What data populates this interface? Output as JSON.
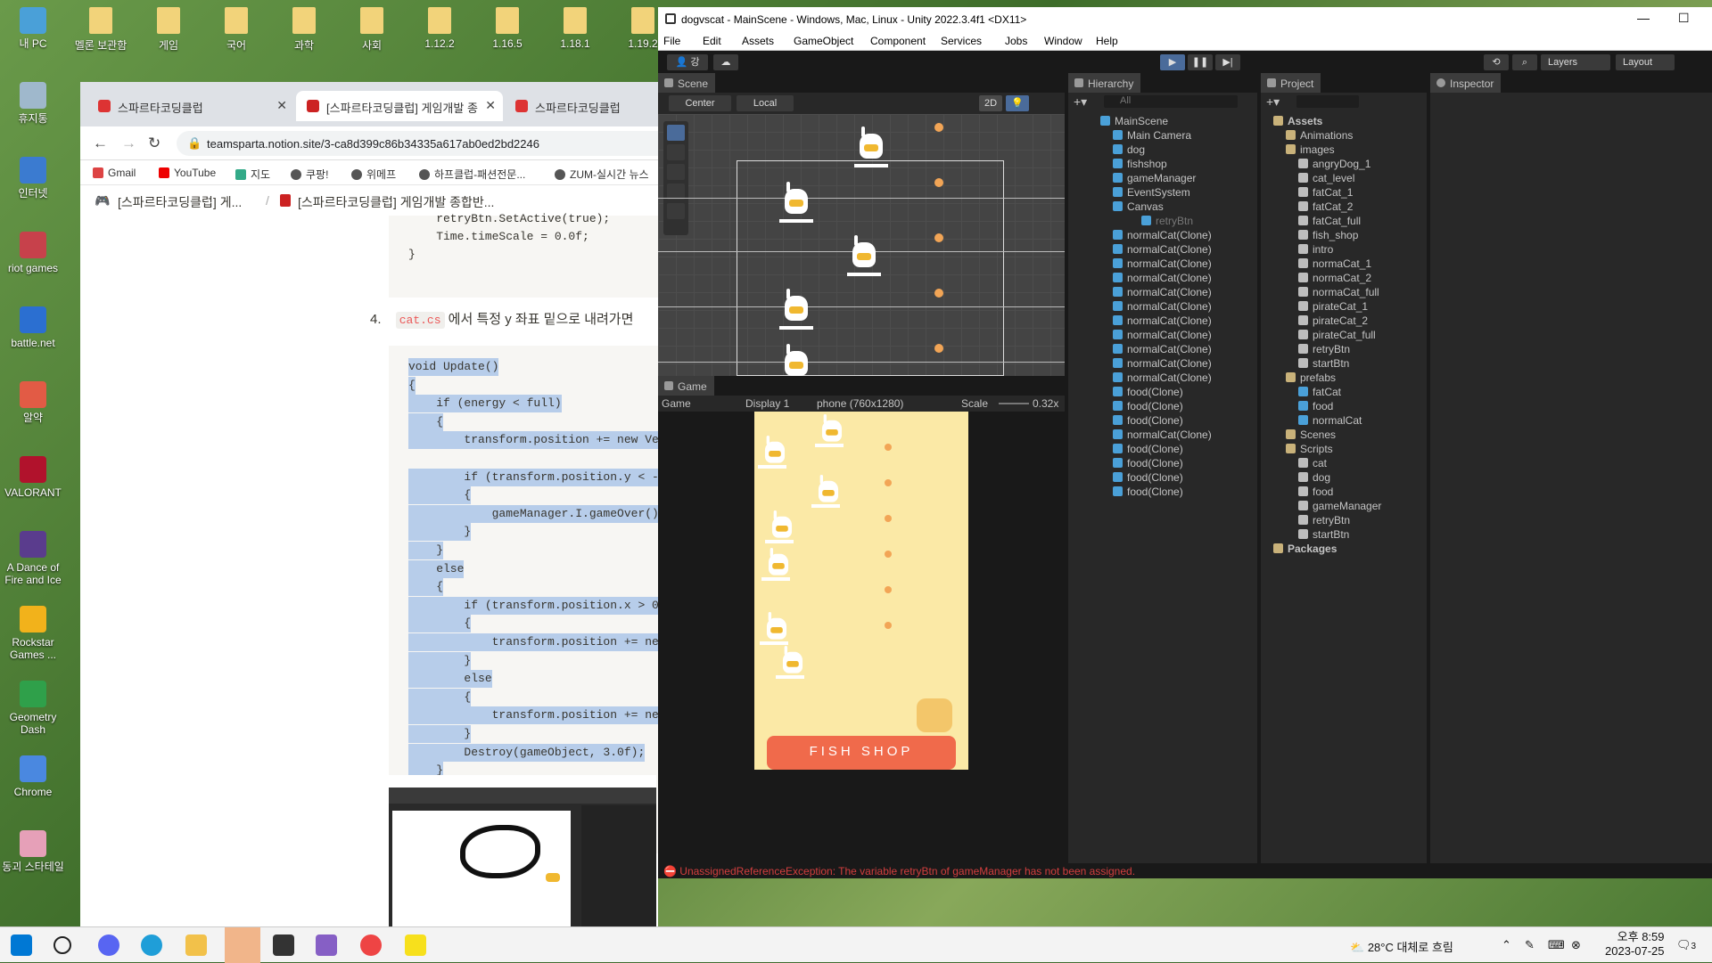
{
  "desktop": {
    "left_icons": [
      "내 PC",
      "휴지통",
      "인터넷",
      "riot games",
      "battle.net",
      "알약",
      "VALORANT",
      "A Dance of Fire and Ice",
      "Rockstar Games ...",
      "Geometry Dash",
      "Chrome",
      "동괴 스타테일"
    ],
    "top_icons": [
      "멜론 보관함",
      "게임",
      "국어",
      "과학",
      "사회",
      "1.12.2",
      "1.16.5",
      "1.18.1",
      "1.19.2"
    ],
    "partial_label": "2"
  },
  "chrome": {
    "tabs": [
      "스파르타코딩클럽",
      "[스파르타코딩클럽] 게임개발 종",
      "스파르타코딩클럽"
    ],
    "url": "teamsparta.notion.site/3-ca8d399c86b34335a617ab0ed2bd2246",
    "bookmarks": [
      "Gmail",
      "YouTube",
      "지도",
      "쿠팡!",
      "위메프",
      "하프클럽-패션전문...",
      "ZUM-실시간 뉴스"
    ],
    "breadcrumb": [
      "[스파르타코딩클럽] 게...",
      "/",
      "[스파르타코딩클럽] 게임개발 종합반..."
    ],
    "top_code": [
      "    retryBtn.SetActive(true);",
      "    Time.timeScale = 0.0f;",
      "}"
    ],
    "step_number": "4.",
    "step_code": "cat.cs",
    "step_text": "에서 특정 y 좌표 밑으로 내려가면",
    "code_lines": [
      "void Update()",
      "{",
      "    if (energy < full)",
      "    {",
      "        transform.position += new Ve",
      "",
      "        if (transform.position.y < -",
      "        {",
      "            gameManager.I.gameOver()",
      "        }",
      "    }",
      "    else",
      "    {",
      "        if (transform.position.x > 0",
      "        {",
      "            transform.position += ne",
      "        }",
      "        else",
      "        {",
      "            transform.position += ne",
      "        }",
      "        Destroy(gameObject, 3.0f);",
      "    }",
      "}"
    ]
  },
  "unity": {
    "title": "dogvscat - MainScene - Windows, Mac, Linux - Unity 2022.3.4f1 <DX11>",
    "menu": [
      "File",
      "Edit",
      "Assets",
      "GameObject",
      "Component",
      "Services",
      "Jobs",
      "Window",
      "Help"
    ],
    "toolbar_right": [
      "Layers",
      "Layout"
    ],
    "account": "강",
    "scene_tab": "Scene",
    "scene_tools": [
      "Center",
      "Local",
      "2D"
    ],
    "game_tab": "Game",
    "game_bar": [
      "Game",
      "Display 1",
      "phone (760x1280)",
      "Scale",
      "0.32x"
    ],
    "hierarchy_tab": "Hierarchy",
    "search_all": "All",
    "hierarchy": [
      "MainScene",
      "Main Camera",
      "dog",
      "fishshop",
      "gameManager",
      "EventSystem",
      "Canvas",
      "retryBtn",
      "normalCat(Clone)",
      "normalCat(Clone)",
      "normalCat(Clone)",
      "normalCat(Clone)",
      "normalCat(Clone)",
      "normalCat(Clone)",
      "normalCat(Clone)",
      "normalCat(Clone)",
      "normalCat(Clone)",
      "normalCat(Clone)",
      "normalCat(Clone)",
      "food(Clone)",
      "food(Clone)",
      "food(Clone)",
      "normalCat(Clone)",
      "food(Clone)",
      "food(Clone)",
      "food(Clone)",
      "food(Clone)"
    ],
    "project_tab": "Project",
    "project": [
      "Assets",
      "Animations",
      "images",
      "angryDog_1",
      "cat_level",
      "fatCat_1",
      "fatCat_2",
      "fatCat_full",
      "fish_shop",
      "intro",
      "normaCat_1",
      "normaCat_2",
      "normaCat_full",
      "pirateCat_1",
      "pirateCat_2",
      "pirateCat_full",
      "retryBtn",
      "startBtn",
      "prefabs",
      "fatCat",
      "food",
      "normalCat",
      "Scenes",
      "Scripts",
      "cat",
      "dog",
      "food",
      "gameManager",
      "retryBtn",
      "startBtn",
      "Packages"
    ],
    "inspector_tab": "Inspector",
    "shop_label": "FISH  SHOP",
    "error": "UnassignedReferenceException: The variable retryBtn of gameManager has not been assigned."
  },
  "taskbar": {
    "weather": "28°C  대체로 흐림",
    "time": "오후 8:59",
    "date": "2023-07-25",
    "notif": "3"
  }
}
